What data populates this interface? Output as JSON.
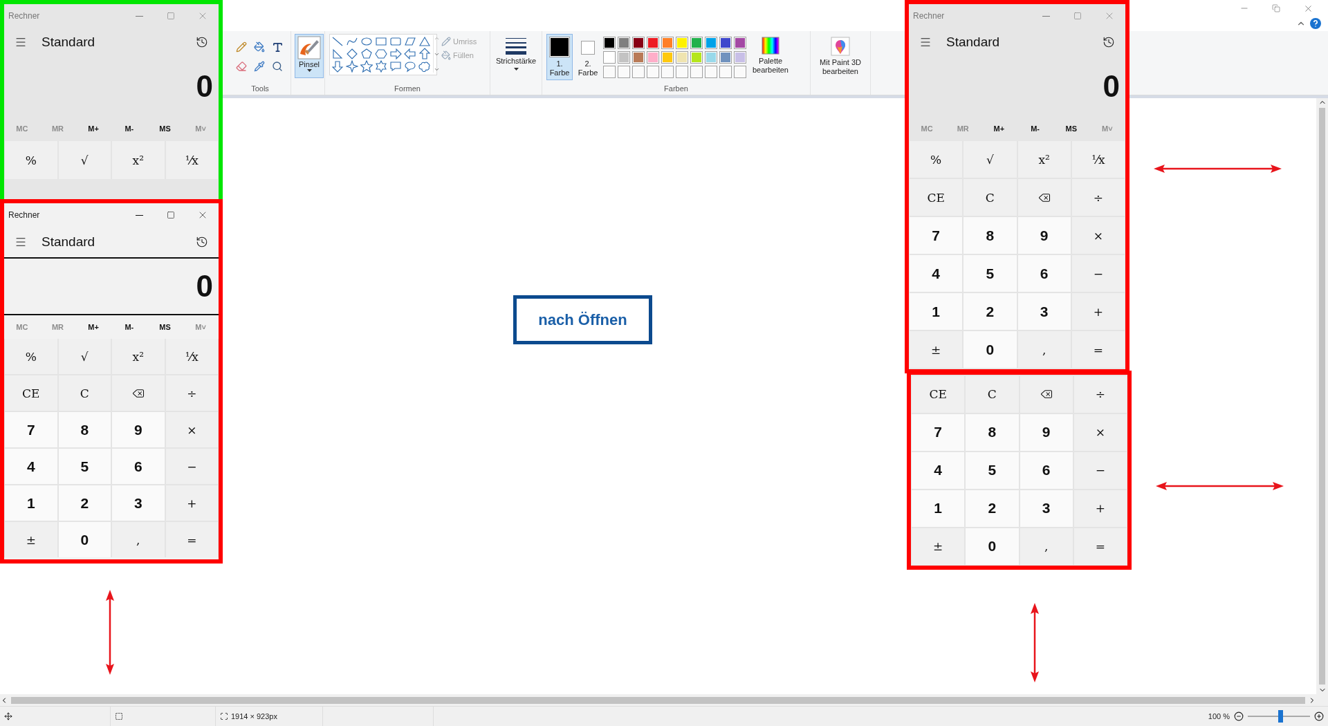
{
  "paint": {
    "ribbon": {
      "tools": {
        "label": "Tools",
        "brush": {
          "label": "Pinsel",
          "selected": true
        }
      },
      "shapes": {
        "label": "Formen",
        "outline": {
          "label": "Umriss",
          "disabled": true
        },
        "fill": {
          "label": "Füllen",
          "disabled": true
        }
      },
      "stroke": {
        "label": "Strichstärke"
      },
      "colors": {
        "label": "Farben",
        "slots": [
          {
            "label": "1. Farbe",
            "color": "#000000",
            "selected": true
          },
          {
            "label": "2. Farbe",
            "color": "#ffffff",
            "selected": false
          }
        ],
        "palette": [
          [
            {
              "color": "#000000"
            },
            {
              "color": "#7f7f7f"
            },
            {
              "color": "#880015"
            },
            {
              "color": "#ed1c24"
            },
            {
              "color": "#ff7f27"
            },
            {
              "color": "#fff200"
            },
            {
              "color": "#22b14c"
            },
            {
              "color": "#00a2e8"
            },
            {
              "color": "#3f48cc"
            },
            {
              "color": "#a349a4"
            }
          ],
          [
            {
              "color": "#ffffff"
            },
            {
              "color": "#c3c3c3"
            },
            {
              "color": "#b97a57"
            },
            {
              "color": "#ffaec9"
            },
            {
              "color": "#ffc90e"
            },
            {
              "color": "#efe4b0"
            },
            {
              "color": "#b5e61d"
            },
            {
              "color": "#99d9ea"
            },
            {
              "color": "#7092be"
            },
            {
              "color": "#c8bfe7"
            }
          ],
          [
            {
              "kind": "empty"
            },
            {
              "kind": "empty"
            },
            {
              "kind": "empty"
            },
            {
              "kind": "empty"
            },
            {
              "kind": "empty"
            },
            {
              "kind": "empty"
            },
            {
              "kind": "empty"
            },
            {
              "kind": "empty"
            },
            {
              "kind": "empty"
            },
            {
              "kind": "empty"
            }
          ]
        ],
        "edit_palette": "Palette bearbeiten"
      },
      "paint3d": "Mit Paint 3D bearbeiten"
    },
    "status_bar": {
      "canvas_size": "1914 × 923px",
      "zoom": "100 %",
      "zoom_slider": {
        "level": 0.52
      }
    }
  },
  "calculators": [
    {
      "kind": "window",
      "color": "#00e600",
      "active": false,
      "display_focused": false,
      "title": "Rechner",
      "mode": "Standard",
      "display": "0",
      "memory": [
        {
          "label": "MC",
          "disabled": true
        },
        {
          "label": "MR",
          "disabled": true
        },
        {
          "label": "M+",
          "disabled": false
        },
        {
          "label": "M-",
          "disabled": false
        },
        {
          "label": "MS",
          "disabled": false
        },
        {
          "label": "M˅",
          "disabled": true
        }
      ],
      "keys": [
        [
          {
            "label": "%",
            "kind": "op"
          },
          {
            "label": "√",
            "kind": "op"
          },
          {
            "label": "x²",
            "kind": "op"
          },
          {
            "label": "⅟x",
            "kind": "op"
          }
        ]
      ]
    },
    {
      "kind": "window",
      "color": "#ff0000",
      "active": true,
      "display_focused": true,
      "title": "Rechner",
      "mode": "Standard",
      "display": "0",
      "memory": [
        {
          "label": "MC",
          "disabled": true
        },
        {
          "label": "MR",
          "disabled": true
        },
        {
          "label": "M+",
          "disabled": false
        },
        {
          "label": "M-",
          "disabled": false
        },
        {
          "label": "MS",
          "disabled": false
        },
        {
          "label": "M˅",
          "disabled": true
        }
      ],
      "keys": [
        [
          {
            "label": "%",
            "kind": "op"
          },
          {
            "label": "√",
            "kind": "op"
          },
          {
            "label": "x²",
            "kind": "op"
          },
          {
            "label": "⅟x",
            "kind": "op"
          }
        ],
        [
          {
            "label": "CE",
            "kind": "op"
          },
          {
            "label": "C",
            "kind": "op"
          },
          {
            "kind": "backspace"
          },
          {
            "label": "÷",
            "kind": "op"
          }
        ],
        [
          {
            "label": "7",
            "kind": "digit"
          },
          {
            "label": "8",
            "kind": "digit"
          },
          {
            "label": "9",
            "kind": "digit"
          },
          {
            "label": "×",
            "kind": "op"
          }
        ],
        [
          {
            "label": "4",
            "kind": "digit"
          },
          {
            "label": "5",
            "kind": "digit"
          },
          {
            "label": "6",
            "kind": "digit"
          },
          {
            "label": "−",
            "kind": "op"
          }
        ],
        [
          {
            "label": "1",
            "kind": "digit"
          },
          {
            "label": "2",
            "kind": "digit"
          },
          {
            "label": "3",
            "kind": "digit"
          },
          {
            "label": "+",
            "kind": "op"
          }
        ],
        [
          {
            "label": "±",
            "kind": "op"
          },
          {
            "label": "0",
            "kind": "digit"
          },
          {
            "label": ",",
            "kind": "op"
          },
          {
            "label": "=",
            "kind": "op"
          }
        ]
      ]
    },
    {
      "kind": "window",
      "color": "#ff0000",
      "active": false,
      "display_focused": false,
      "title": "Rechner",
      "mode": "Standard",
      "display": "0",
      "memory": [
        {
          "label": "MC",
          "disabled": true
        },
        {
          "label": "MR",
          "disabled": true
        },
        {
          "label": "M+",
          "disabled": false
        },
        {
          "label": "M-",
          "disabled": false
        },
        {
          "label": "MS",
          "disabled": false
        },
        {
          "label": "M˅",
          "disabled": true
        }
      ],
      "keys": [
        [
          {
            "label": "%",
            "kind": "op"
          },
          {
            "label": "√",
            "kind": "op"
          },
          {
            "label": "x²",
            "kind": "op"
          },
          {
            "label": "⅟x",
            "kind": "op"
          }
        ],
        [
          {
            "label": "CE",
            "kind": "op"
          },
          {
            "label": "C",
            "kind": "op"
          },
          {
            "kind": "backspace"
          },
          {
            "label": "÷",
            "kind": "op"
          }
        ],
        [
          {
            "label": "7",
            "kind": "digit"
          },
          {
            "label": "8",
            "kind": "digit"
          },
          {
            "label": "9",
            "kind": "digit"
          },
          {
            "label": "×",
            "kind": "op"
          }
        ],
        [
          {
            "label": "4",
            "kind": "digit"
          },
          {
            "label": "5",
            "kind": "digit"
          },
          {
            "label": "6",
            "kind": "digit"
          },
          {
            "label": "−",
            "kind": "op"
          }
        ],
        [
          {
            "label": "1",
            "kind": "digit"
          },
          {
            "label": "2",
            "kind": "digit"
          },
          {
            "label": "3",
            "kind": "digit"
          },
          {
            "label": "+",
            "kind": "op"
          }
        ],
        [
          {
            "label": "±",
            "kind": "op"
          },
          {
            "label": "0",
            "kind": "digit"
          },
          {
            "label": ",",
            "kind": "op"
          },
          {
            "label": "=",
            "kind": "op"
          }
        ]
      ]
    },
    {
      "kind": "keypad",
      "color": "#ff0000",
      "keys": [
        [
          {
            "label": "CE",
            "kind": "op"
          },
          {
            "label": "C",
            "kind": "op"
          },
          {
            "kind": "backspace"
          },
          {
            "label": "÷",
            "kind": "op"
          }
        ],
        [
          {
            "label": "7",
            "kind": "digit"
          },
          {
            "label": "8",
            "kind": "digit"
          },
          {
            "label": "9",
            "kind": "digit"
          },
          {
            "label": "×",
            "kind": "op"
          }
        ],
        [
          {
            "label": "4",
            "kind": "digit"
          },
          {
            "label": "5",
            "kind": "digit"
          },
          {
            "label": "6",
            "kind": "digit"
          },
          {
            "label": "−",
            "kind": "op"
          }
        ],
        [
          {
            "label": "1",
            "kind": "digit"
          },
          {
            "label": "2",
            "kind": "digit"
          },
          {
            "label": "3",
            "kind": "digit"
          },
          {
            "label": "+",
            "kind": "op"
          }
        ],
        [
          {
            "label": "±",
            "kind": "op"
          },
          {
            "label": "0",
            "kind": "digit"
          },
          {
            "label": ",",
            "kind": "op"
          },
          {
            "label": "=",
            "kind": "op"
          }
        ]
      ]
    }
  ],
  "annotations": {
    "label": "nach Öffnen"
  }
}
